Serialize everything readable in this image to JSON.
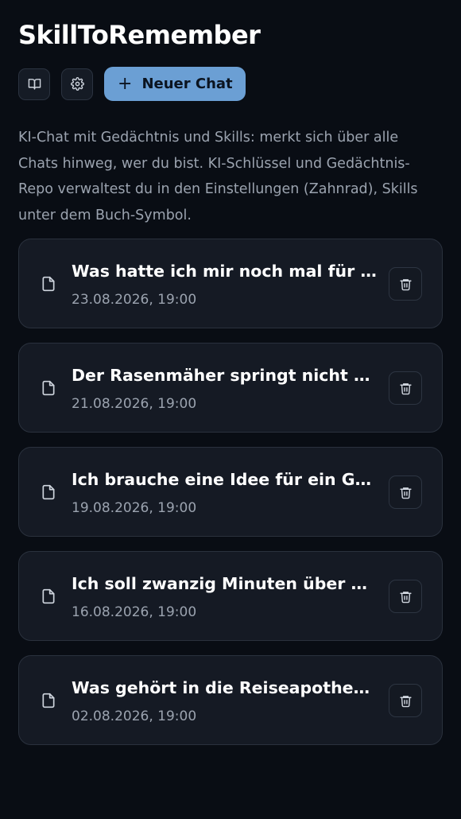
{
  "app": {
    "title": "SkillToRemember",
    "description": "KI-Chat mit Gedächtnis und Skills: merkt sich über alle Chats hinweg, wer du bist. KI-Schlüssel und Gedächtnis-Repo verwaltest du in den Einstellungen (Zahnrad), Skills unter dem Buch-Symbol."
  },
  "toolbar": {
    "skills_icon": "book-icon",
    "settings_icon": "gear-icon",
    "new_chat_icon": "plus-icon",
    "new_chat_symbol": "+",
    "new_chat_label": "Neuer Chat"
  },
  "colors": {
    "background": "#090d14",
    "card": "#151a24",
    "accent": "#6b9fd4",
    "muted_text": "#9ba3af"
  },
  "chats": [
    {
      "title": "Was hatte ich mir noch mal für d...",
      "date": "23.08.2026, 19:00"
    },
    {
      "title": "Der Rasenmäher springt nicht an....",
      "date": "21.08.2026, 19:00"
    },
    {
      "title": "Ich brauche eine Idee für ein Ges...",
      "date": "19.08.2026, 19:00"
    },
    {
      "title": "Ich soll zwanzig Minuten über Sa...",
      "date": "16.08.2026, 19:00"
    },
    {
      "title": "Was gehört in die Reiseapotheke ...",
      "date": "02.08.2026, 19:00"
    }
  ]
}
